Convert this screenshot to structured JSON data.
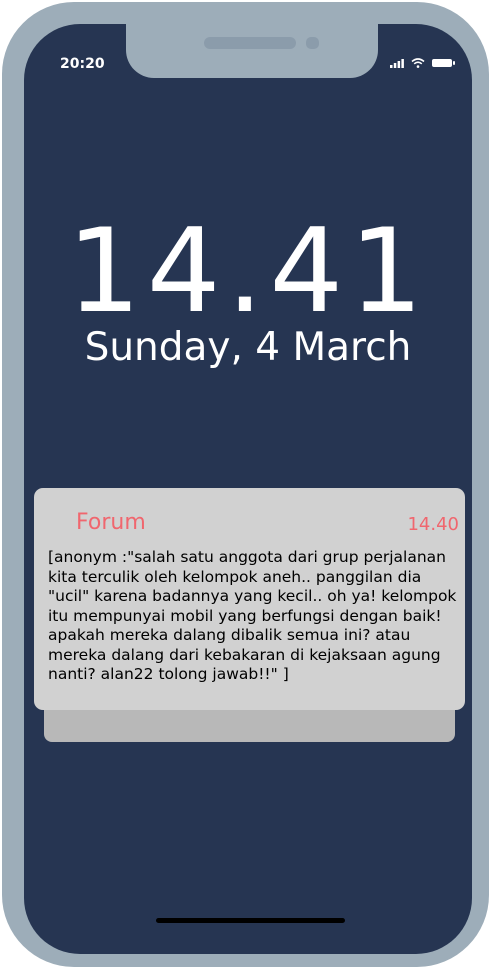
{
  "status_bar": {
    "time": "20:20",
    "icons": [
      "signal-icon",
      "wifi-icon",
      "battery-icon"
    ]
  },
  "lock_screen": {
    "clock": "14.41",
    "date": "Sunday, 4 March"
  },
  "notification": {
    "app_name": "Forum",
    "time": "14.40",
    "body": "[anonym :\"salah satu anggota dari grup perjalanan kita terculik oleh kelompok aneh.. panggilan dia \"ucil\" karena badannya yang kecil.. oh ya! kelompok itu mempunyai mobil yang berfungsi dengan baik! apakah mereka dalang dibalik semua ini? atau mereka dalang dari kebakaran di kejaksaan agung nanti? alan22 tolong jawab!!\" ]",
    "accent_color": "#f0666e"
  },
  "colors": {
    "frame": "#9dadb9",
    "screen": "#263552",
    "card": "#d1d1d1"
  }
}
